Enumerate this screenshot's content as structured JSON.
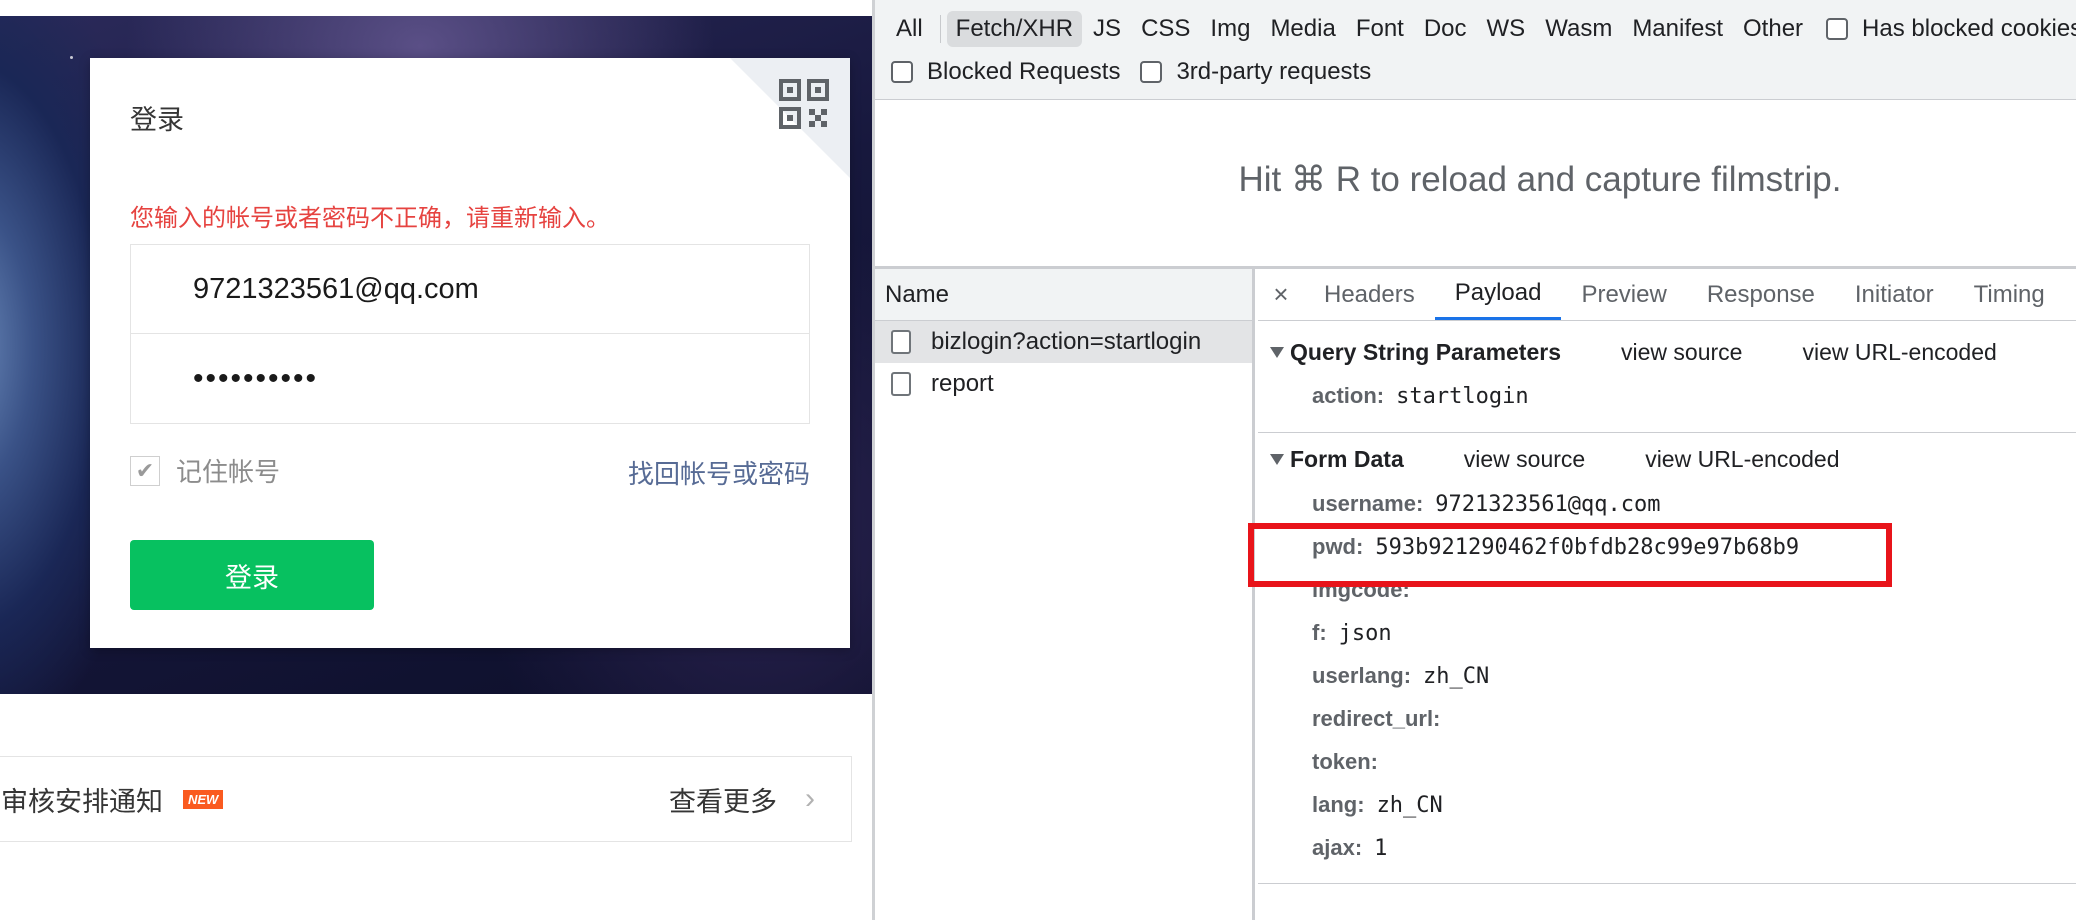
{
  "login_page": {
    "card_title": "登录",
    "error_message": "您输入的帐号或者密码不正确，请重新输入。",
    "username_value": "9721323561@qq.com",
    "password_value": "••••••••••",
    "remember_checked": true,
    "remember_label": "记住帐号",
    "forgot_link": "找回帐号或密码",
    "login_button": "登录",
    "notice_text": "审核安排通知",
    "new_badge": "NEW",
    "more_link": "查看更多",
    "icons": [
      "qr-code-icon",
      "checkmark-icon",
      "chevron-right-icon"
    ],
    "colors": {
      "error": "#e64340",
      "primary_button": "#07c160",
      "link": "#576b95",
      "badge": "#fa5a1f"
    }
  },
  "devtools": {
    "filter_types": [
      "All",
      "Fetch/XHR",
      "JS",
      "CSS",
      "Img",
      "Media",
      "Font",
      "Doc",
      "WS",
      "Wasm",
      "Manifest",
      "Other"
    ],
    "active_filter": "Fetch/XHR",
    "has_blocked_cookies": "Has blocked cookies",
    "blocked_requests": "Blocked Requests",
    "third_party": "3rd-party requests",
    "filmstrip_message": "Hit ⌘ R to reload and capture filmstrip.",
    "name_header": "Name",
    "requests": [
      {
        "name": "bizlogin?action=startlogin",
        "selected": true
      },
      {
        "name": "report",
        "selected": false
      }
    ],
    "close_label": "×",
    "tabs": [
      "Headers",
      "Payload",
      "Preview",
      "Response",
      "Initiator",
      "Timing"
    ],
    "active_tab": "Payload",
    "query_section": {
      "title": "Query String Parameters",
      "view_source": "view source",
      "view_encoded": "view URL-encoded",
      "params": [
        {
          "key": "action:",
          "value": "startlogin"
        }
      ]
    },
    "form_section": {
      "title": "Form Data",
      "view_source": "view source",
      "view_encoded": "view URL-encoded",
      "params": [
        {
          "key": "username:",
          "value": "9721323561@qq.com"
        },
        {
          "key": "pwd:",
          "value": "593b921290462f0bfdb28c99e97b68b9"
        },
        {
          "key": "imgcode:",
          "value": ""
        },
        {
          "key": "f:",
          "value": "json"
        },
        {
          "key": "userlang:",
          "value": "zh_CN"
        },
        {
          "key": "redirect_url:",
          "value": ""
        },
        {
          "key": "token:",
          "value": ""
        },
        {
          "key": "lang:",
          "value": "zh_CN"
        },
        {
          "key": "ajax:",
          "value": "1"
        }
      ]
    },
    "highlight_color": "#e8141a"
  }
}
